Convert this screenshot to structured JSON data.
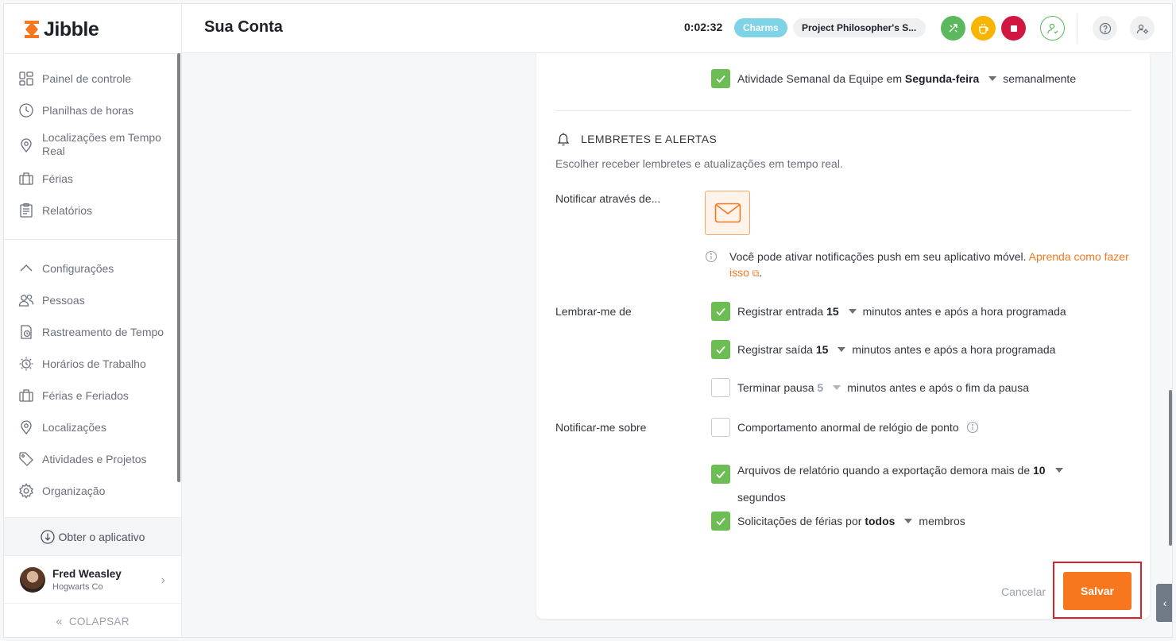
{
  "app": {
    "name": "Jibble"
  },
  "sidebar": {
    "items": [
      {
        "label": "Painel de controle",
        "icon": "dashboard-icon"
      },
      {
        "label": "Planilhas de horas",
        "icon": "clock-icon"
      },
      {
        "label": "Localizações em Tempo Real",
        "icon": "location-pin-icon"
      },
      {
        "label": "Férias",
        "icon": "briefcase-icon"
      },
      {
        "label": "Relatórios",
        "icon": "clipboard-icon"
      }
    ],
    "settings": [
      {
        "label": "Configurações",
        "icon": "chevron-up-icon"
      },
      {
        "label": "Pessoas",
        "icon": "people-icon"
      },
      {
        "label": "Rastreamento de Tempo",
        "icon": "time-tracking-icon"
      },
      {
        "label": "Horários de Trabalho",
        "icon": "schedule-icon"
      },
      {
        "label": "Férias e Feriados",
        "icon": "briefcase-icon"
      },
      {
        "label": "Localizações",
        "icon": "location-pin-icon"
      },
      {
        "label": "Atividades e Projetos",
        "icon": "tag-icon"
      },
      {
        "label": "Organização",
        "icon": "gear-icon"
      }
    ],
    "get_app": "Obter o aplicativo",
    "user": {
      "name": "Fred Weasley",
      "org": "Hogwarts Co"
    },
    "collapse": "COLAPSAR"
  },
  "header": {
    "title": "Sua Conta",
    "timer": "0:02:32",
    "activity": "Charms",
    "project": "Project Philosopher's S..."
  },
  "content": {
    "weekly": {
      "text": "Atividade Semanal da Equipe em",
      "day": "Segunda-feira",
      "suffix": "semanalmente",
      "checked": true
    },
    "section_title": "LEMBRETES E ALERTAS",
    "section_desc": "Escolher receber lembretes e atualizações em tempo real.",
    "notify_via_label": "Notificar através de...",
    "push_info": "Você pode ativar notificações push em seu aplicativo móvel.",
    "push_link": "Aprenda como fazer isso",
    "remind_label": "Lembrar-me de",
    "reminders": [
      {
        "text": "Registrar entrada",
        "value": "15",
        "suffix": "minutos antes e após a hora programada",
        "checked": true
      },
      {
        "text": "Registrar saída",
        "value": "15",
        "suffix": "minutos antes e após a hora programada",
        "checked": true
      },
      {
        "text": "Terminar pausa",
        "value": "5",
        "suffix": "minutos antes e após o fim da pausa",
        "checked": false
      }
    ],
    "notify_about_label": "Notificar-me sobre",
    "notify_about": [
      {
        "text": "Comportamento anormal de relógio de ponto",
        "checked": false
      },
      {
        "text": "Arquivos de relatório quando a exportação demora mais de",
        "value": "10",
        "suffix": "segundos",
        "checked": true
      },
      {
        "text": "Solicitações de férias por",
        "value": "todos",
        "suffix": "membros",
        "checked": true
      }
    ],
    "cancel": "Cancelar",
    "save": "Salvar"
  },
  "colors": {
    "brand_orange": "#f7771f",
    "check_green": "#6cbd54",
    "highlight_red": "#d8232a"
  }
}
